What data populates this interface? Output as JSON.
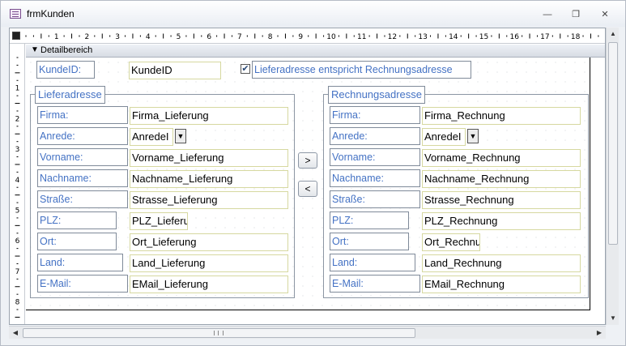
{
  "window": {
    "title": "frmKunden",
    "minimize_icon": "minimize-icon",
    "restore_icon": "restore-icon",
    "close_icon": "close-icon"
  },
  "ruler": {
    "h_numbers": [
      "1",
      "2",
      "3",
      "4",
      "5",
      "6",
      "7",
      "8",
      "9",
      "10",
      "11",
      "12",
      "13",
      "14",
      "15",
      "16",
      "17",
      "18"
    ],
    "v_numbers": [
      "1",
      "2",
      "3",
      "4",
      "5",
      "6",
      "7",
      "8"
    ]
  },
  "section": {
    "label": "Detailbereich"
  },
  "top": {
    "kundeid_label": "KundeID:",
    "kundeid_field": "KundeID",
    "checkbox_checked": true,
    "checkbox_label": "Lieferadresse entspricht Rechnungsadresse"
  },
  "lieferadresse": {
    "title": "Lieferadresse",
    "rows": [
      {
        "label": "Firma:",
        "value": "Firma_Lieferung"
      },
      {
        "label": "Anrede:",
        "value": "AnredeI"
      },
      {
        "label": "Vorname:",
        "value": "Vorname_Lieferung"
      },
      {
        "label": "Nachname:",
        "value": "Nachname_Lieferung"
      },
      {
        "label": "Straße:",
        "value": "Strasse_Lieferung"
      },
      {
        "label": "PLZ:",
        "value": "PLZ_Lieferu"
      },
      {
        "label": "Ort:",
        "value": "Ort_Lieferung"
      },
      {
        "label": "Land:",
        "value": "Land_Lieferung"
      },
      {
        "label": "E-Mail:",
        "value": "EMail_Lieferung"
      }
    ]
  },
  "rechnungsadresse": {
    "title": "Rechnungsadresse",
    "rows": [
      {
        "label": "Firma:",
        "value": "Firma_Rechnung"
      },
      {
        "label": "Anrede:",
        "value": "AnredeI"
      },
      {
        "label": "Vorname:",
        "value": "Vorname_Rechnung"
      },
      {
        "label": "Nachname:",
        "value": "Nachname_Rechnung"
      },
      {
        "label": "Straße:",
        "value": "Strasse_Rechnung"
      },
      {
        "label": "PLZ:",
        "value": "PLZ_Rechnung"
      },
      {
        "label": "Ort:",
        "value": "Ort_Rechnu"
      },
      {
        "label": "Land:",
        "value": "Land_Rechnung"
      },
      {
        "label": "E-Mail:",
        "value": "EMail_Rechnung"
      }
    ]
  },
  "buttons": {
    "copy_right": ">",
    "copy_left": "<"
  }
}
